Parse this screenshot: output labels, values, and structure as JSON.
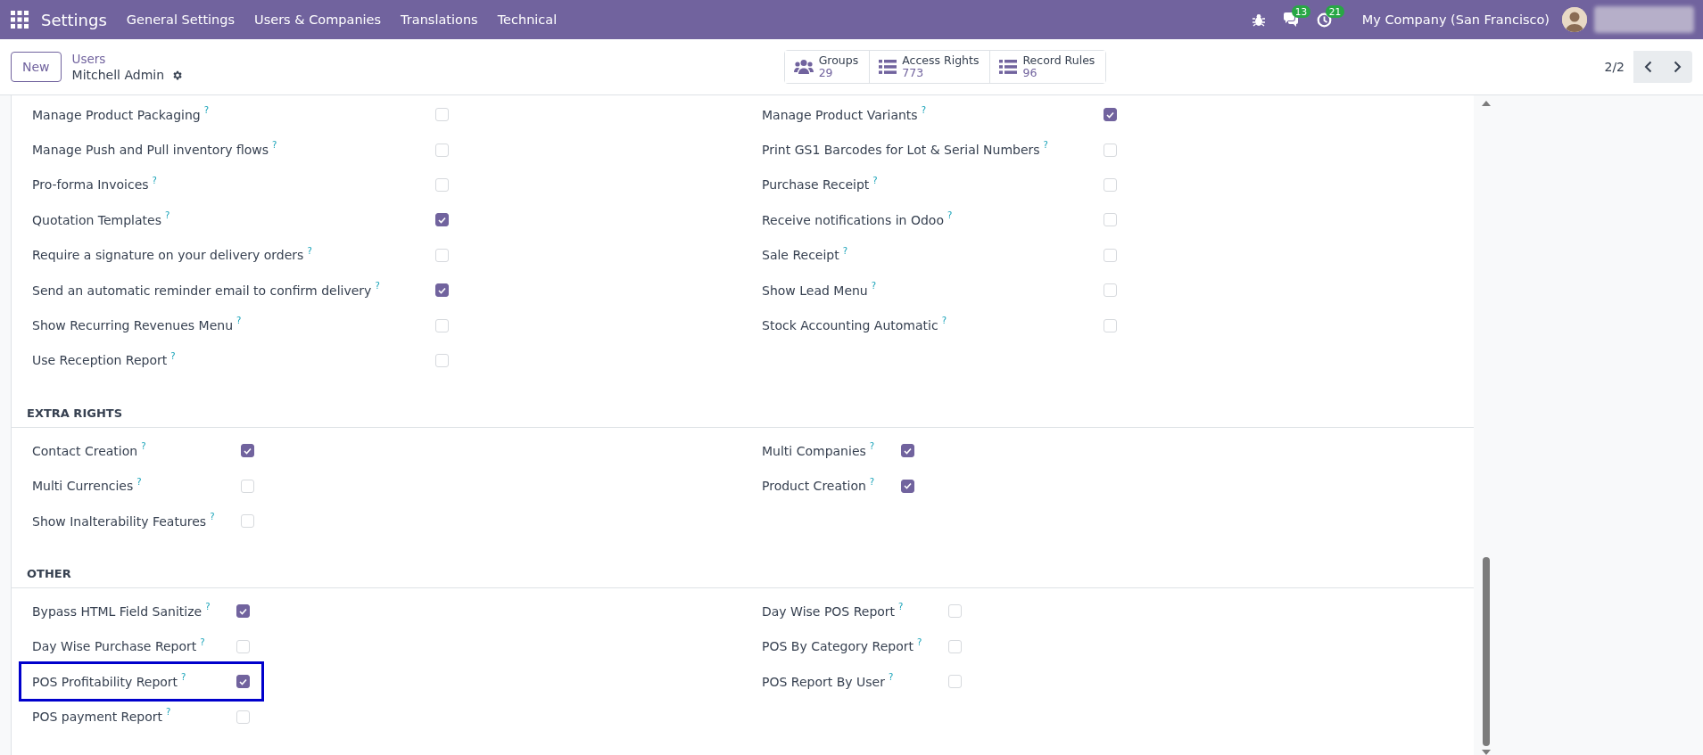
{
  "navbar": {
    "app_title": "Settings",
    "menu": [
      "General Settings",
      "Users & Companies",
      "Translations",
      "Technical"
    ],
    "messages_count": "13",
    "activities_count": "21",
    "company": "My Company (San Francisco)"
  },
  "control_panel": {
    "new_button": "New",
    "breadcrumb": "Users",
    "record_name": "Mitchell Admin",
    "smart_buttons": [
      {
        "label": "Groups",
        "count": "29",
        "kind": "groups"
      },
      {
        "label": "Access Rights",
        "count": "773",
        "kind": "list"
      },
      {
        "label": "Record Rules",
        "count": "96",
        "kind": "list"
      }
    ],
    "pager": "2/2"
  },
  "sections": [
    {
      "left": [
        {
          "label": "Manage Product Packaging",
          "checked": false,
          "highlighted": false
        },
        {
          "label": "Manage Push and Pull inventory flows",
          "checked": false,
          "highlighted": false
        },
        {
          "label": "Pro-forma Invoices",
          "checked": false,
          "highlighted": false
        },
        {
          "label": "Quotation Templates",
          "checked": true,
          "highlighted": false
        },
        {
          "label": "Require a signature on your delivery orders",
          "checked": false,
          "highlighted": false
        },
        {
          "label": "Send an automatic reminder email to confirm delivery",
          "checked": true,
          "highlighted": false
        },
        {
          "label": "Show Recurring Revenues Menu",
          "checked": false,
          "highlighted": false
        },
        {
          "label": "Use Reception Report",
          "checked": false,
          "highlighted": false
        }
      ],
      "right": [
        {
          "label": "Manage Product Variants",
          "checked": true,
          "highlighted": false
        },
        {
          "label": "Print GS1 Barcodes for Lot & Serial Numbers",
          "checked": false,
          "highlighted": false
        },
        {
          "label": "Purchase Receipt",
          "checked": false,
          "highlighted": false
        },
        {
          "label": "Receive notifications in Odoo",
          "checked": false,
          "highlighted": false
        },
        {
          "label": "Sale Receipt",
          "checked": false,
          "highlighted": false
        },
        {
          "label": "Show Lead Menu",
          "checked": false,
          "highlighted": false
        },
        {
          "label": "Stock Accounting Automatic",
          "checked": false,
          "highlighted": false
        }
      ]
    },
    {
      "title": "EXTRA RIGHTS",
      "left": [
        {
          "label": "Contact Creation",
          "checked": true,
          "highlighted": false
        },
        {
          "label": "Multi Currencies",
          "checked": false,
          "highlighted": false
        },
        {
          "label": "Show Inalterability Features",
          "checked": false,
          "highlighted": false
        }
      ],
      "right": [
        {
          "label": "Multi Companies",
          "checked": true,
          "highlighted": false
        },
        {
          "label": "Product Creation",
          "checked": true,
          "highlighted": false
        }
      ]
    },
    {
      "title": "OTHER",
      "left": [
        {
          "label": "Bypass HTML Field Sanitize",
          "checked": true,
          "highlighted": false
        },
        {
          "label": "Day Wise Purchase Report",
          "checked": false,
          "highlighted": false
        },
        {
          "label": "POS Profitability Report",
          "checked": true,
          "highlighted": true
        },
        {
          "label": "POS payment Report",
          "checked": false,
          "highlighted": false
        }
      ],
      "right": [
        {
          "label": "Day Wise POS Report",
          "checked": false,
          "highlighted": false
        },
        {
          "label": "POS By Category Report",
          "checked": false,
          "highlighted": false
        },
        {
          "label": "POS Report By User",
          "checked": false,
          "highlighted": false
        }
      ]
    }
  ],
  "help_mark": "?"
}
